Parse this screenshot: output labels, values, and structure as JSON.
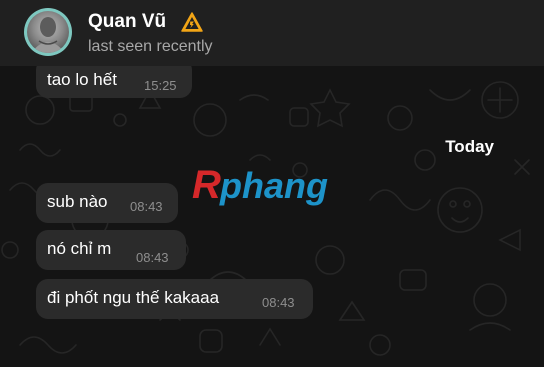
{
  "header": {
    "contact_name": "Quan Vũ",
    "status": "last seen recently",
    "badge_icon": "warning-icon",
    "avatar_icon": "profile-photo"
  },
  "date_separator": "Today",
  "watermark": {
    "first_letter": "R",
    "rest": "phang",
    "colors": [
      "#d6282a",
      "#1d93c9"
    ]
  },
  "messages": [
    {
      "text": "tao lo hết",
      "time": "15:25"
    },
    {
      "text": "sub nào",
      "time": "08:43"
    },
    {
      "text": "nó chỉ m",
      "time": "08:43"
    },
    {
      "text": "đi phốt ngu thế kakaaa",
      "time": "08:43"
    }
  ],
  "colors": {
    "header_bg": "#202020",
    "chat_bg": "#141414",
    "bubble_bg": "#2b2b2b",
    "avatar_ring": "#7ec8c0",
    "timestamp": "#8e8e8e"
  }
}
